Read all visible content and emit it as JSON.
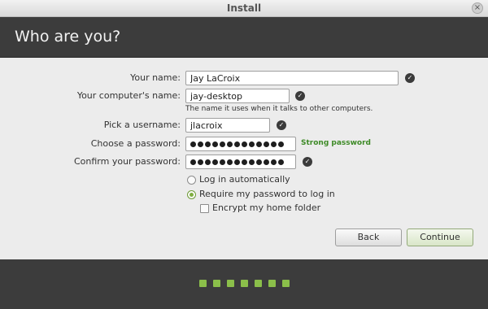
{
  "window": {
    "title": "Install",
    "close_glyph": "×"
  },
  "page": {
    "heading": "Who are you?"
  },
  "form": {
    "name_label": "Your name:",
    "name_value": "Jay LaCroix",
    "computer_label": "Your computer's name:",
    "computer_value": "jay-desktop",
    "computer_hint": "The name it uses when it talks to other computers.",
    "username_label": "Pick a username:",
    "username_value": "jlacroix",
    "password_label": "Choose a password:",
    "password_length": 13,
    "password_strength": "Strong password",
    "confirm_label": "Confirm your password:",
    "confirm_length": 13,
    "check_glyph": "✓"
  },
  "login_options": {
    "auto_login": "Log in automatically",
    "require_password": "Require my password to log in",
    "selected": "require_password",
    "encrypt_home": "Encrypt my home folder",
    "encrypt_checked": false
  },
  "buttons": {
    "back": "Back",
    "continue": "Continue"
  },
  "progress": {
    "total_steps": 7
  },
  "colors": {
    "accent": "#8bbf4a",
    "strength": "#3d8a26",
    "header_bg": "#3c3c3c"
  },
  "icons": {
    "valid": "checkmark-icon",
    "close": "close-icon"
  }
}
